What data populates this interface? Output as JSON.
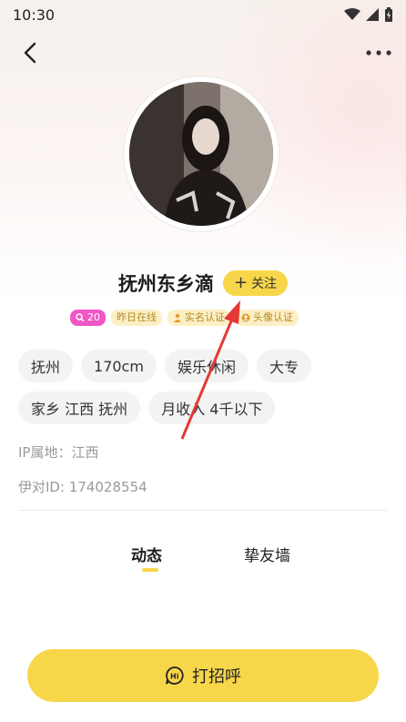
{
  "status": {
    "time": "10:30"
  },
  "profile": {
    "name": "抚州东乡滴",
    "follow_label": "关注",
    "badges": [
      {
        "text": "20",
        "style": "pink",
        "icon": "search-icon"
      },
      {
        "text": "昨日在线",
        "style": "yellow"
      },
      {
        "text": "实名认证",
        "style": "yellow",
        "icon": "person-icon"
      },
      {
        "text": "头像认证",
        "style": "yellow",
        "icon": "avatar-verify-icon"
      }
    ],
    "tags": [
      "抚州",
      "170cm",
      "娱乐休闲",
      "大专",
      "家乡 江西 抚州",
      "月收入 4千以下"
    ],
    "ip_location": "IP属地：江西",
    "user_id": "伊对ID: 174028554"
  },
  "tabs": [
    {
      "label": "动态",
      "active": true
    },
    {
      "label": "挚友墙",
      "active": false
    }
  ],
  "action": {
    "greet_label": "打招呼"
  },
  "colors": {
    "accent": "#f7d64a",
    "pink_badge": "#f057c5",
    "badge_bg": "#fcefc6",
    "annotation": "#e53935"
  }
}
